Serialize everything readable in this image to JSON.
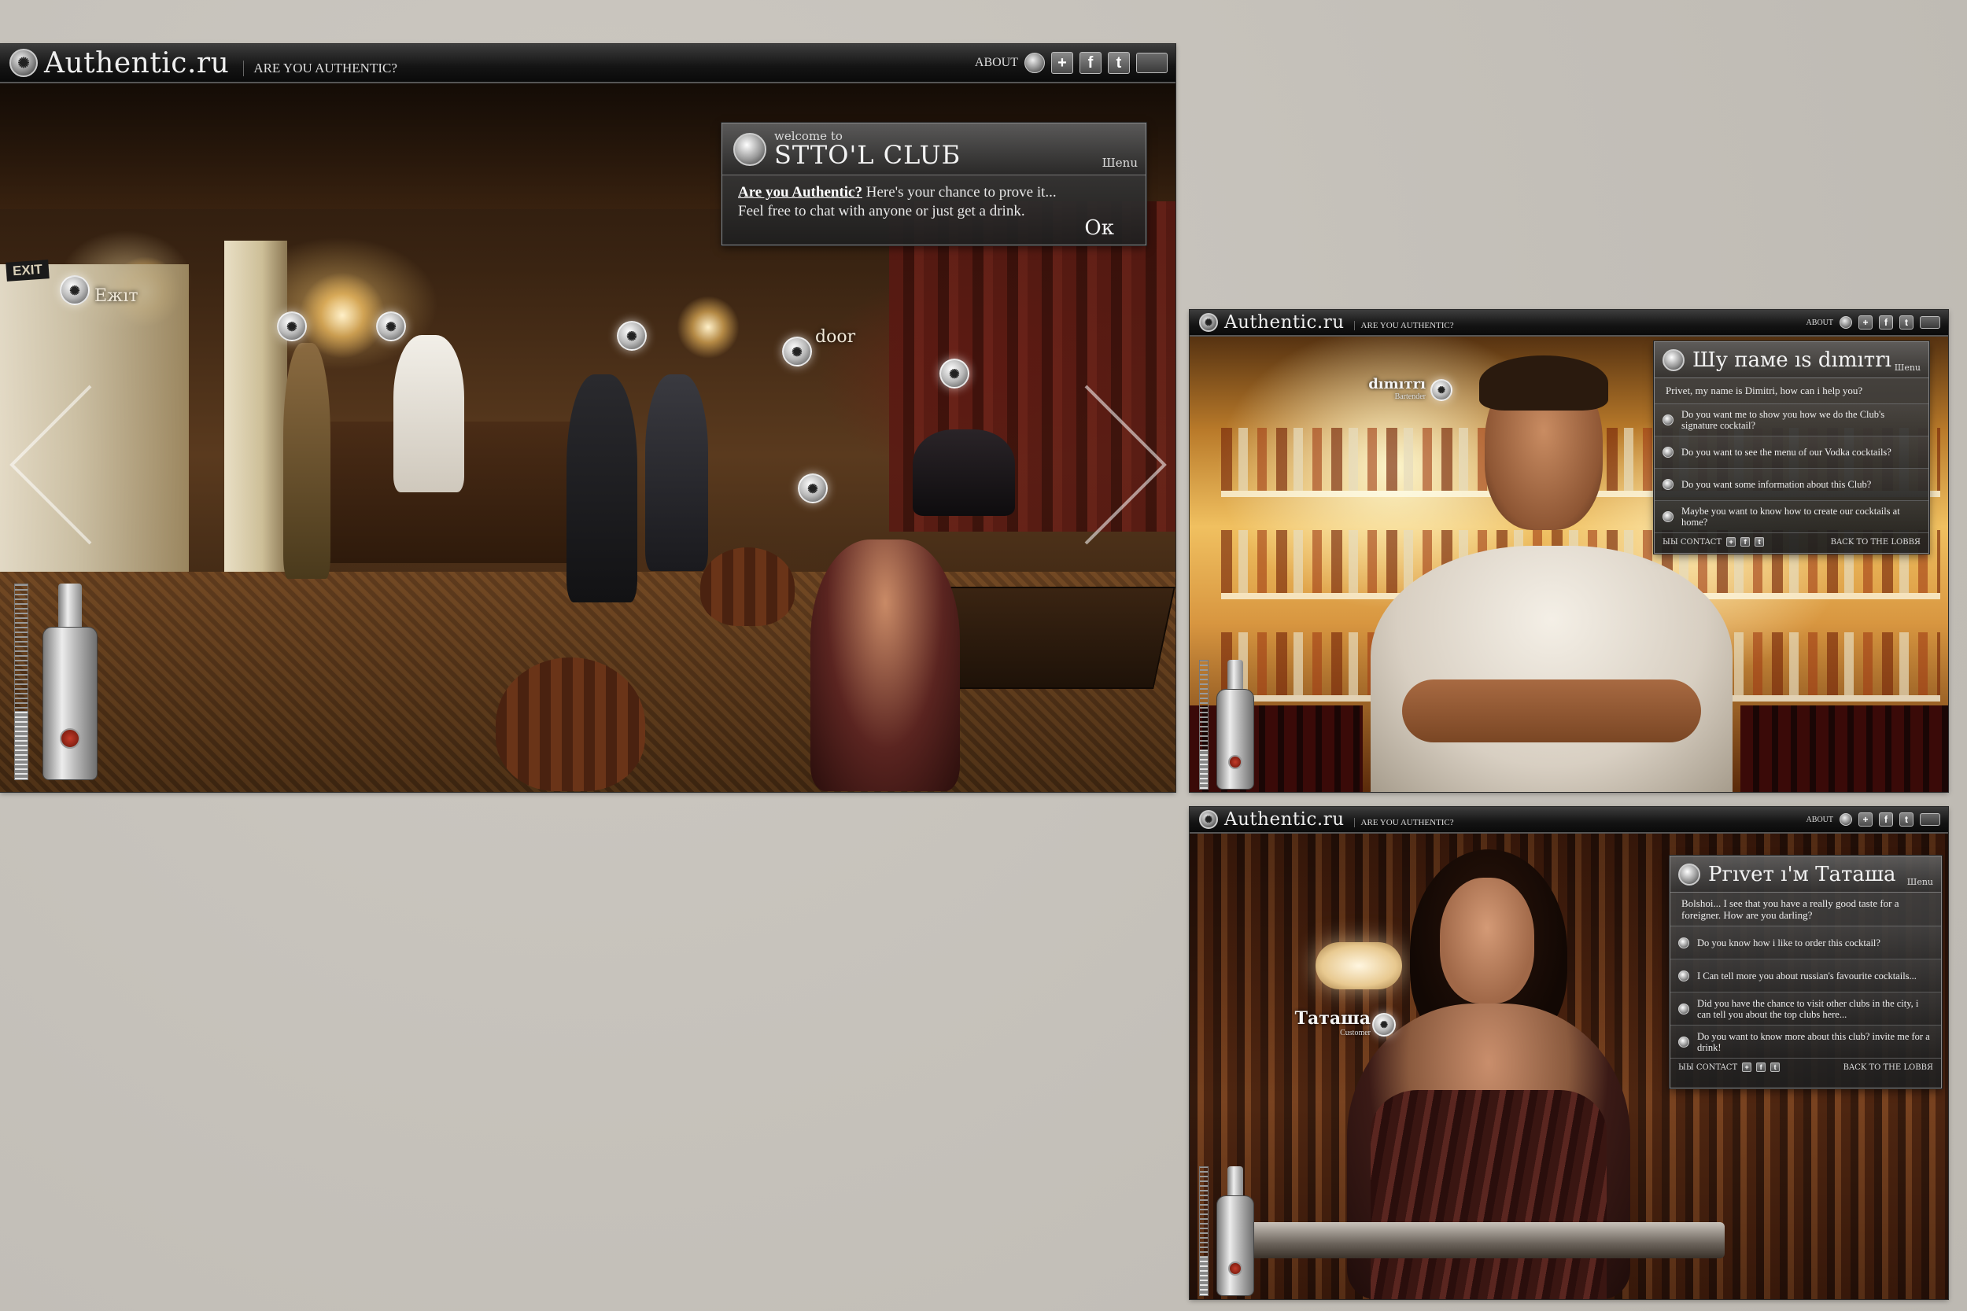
{
  "brand": {
    "logo_text": "Authentic.ru",
    "tagline": "ARE YOU AUTHENTIC?",
    "about_label": "ABOUT"
  },
  "topbar_buttons": {
    "plus_icon": "+",
    "facebook_icon": "f",
    "twitter_icon": "t"
  },
  "lobby": {
    "welcome_subtitle": "welcome to",
    "welcome_title": "STTO'L CLUБ",
    "menu_label": "Шenu",
    "message_link": "Are you Authentic?",
    "message_rest": " Here's your chance to prove it...",
    "message_line2": "Feel free to chat with anyone or just get a drink.",
    "ok_label": "Oк",
    "exit_sign": "EXIT",
    "hotspot_exit_label": "Ежıт",
    "hotspot_door_label": "door",
    "bottle_level": 0.35
  },
  "dimitri": {
    "char_name": "dımıтrı",
    "char_role": "Bartender",
    "panel_title": "Шу паме ıs dımıтrı",
    "menu_label": "Шenu",
    "intro": "Privet, my name is Dimitri, how can i help you?",
    "options": [
      "Do you want me to show you how we do the Club's signature cocktail?",
      "Do you want to see the menu of our Vodka cocktails?",
      "Do you want some information about this Club?",
      "Maybe you want to know how to create our cocktails at home?"
    ],
    "footer_left": "ЫЫ CONTACT",
    "footer_right": "BACK TO THE LOBBЯ",
    "bottle_level": 0.3
  },
  "tatiana": {
    "char_name": "Таташа",
    "char_role": "Customer",
    "panel_title": "Ргıvет ı'м Таташа",
    "menu_label": "Шenu",
    "intro": "Bolshoi... I see that you have a really good taste for a foreigner. How are you darling?",
    "options": [
      "Do you know how i like to order this cocktail?",
      "I Can tell more you about russian's favourite cocktails...",
      "Did you have the chance to visit other clubs in the city, i can tell you about the top clubs here...",
      "Do you want to know more about this club? invite me for a drink!"
    ],
    "footer_left": "ЫЫ CONTACT",
    "footer_right": "BACK TO THE LOBBЯ",
    "bottle_level": 0.3
  },
  "colors": {
    "background": "#c7c3bc",
    "bar_top": "#141414",
    "panel": "#3a3a3a",
    "text": "#eeeeee"
  },
  "icons": {
    "logo": "spiral-emblem-icon",
    "hotspot": "spiral-emblem-icon",
    "nav_prev": "chevron-left-icon",
    "nav_next": "chevron-right-icon"
  }
}
